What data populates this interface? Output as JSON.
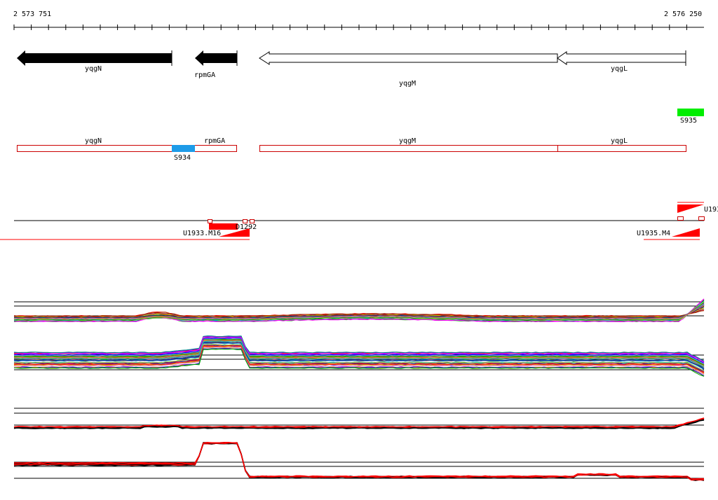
{
  "axis": {
    "start_label": "2 573 751",
    "end_label": "2 576 250"
  },
  "genes": [
    {
      "name": "yqgN",
      "strand": "reverse",
      "style": "filled"
    },
    {
      "name": "rpmGA",
      "strand": "reverse",
      "style": "filled"
    },
    {
      "name": "yqgM",
      "strand": "reverse",
      "style": "outline"
    },
    {
      "name": "yqgL",
      "strand": "reverse",
      "style": "outline"
    }
  ],
  "segments": [
    {
      "name": "S935",
      "color": "#00ee00"
    },
    {
      "name": "S934",
      "color": "#1e9be8"
    }
  ],
  "annotation_genes": [
    "yqgN",
    "rpmGA",
    "yqgM",
    "yqgL"
  ],
  "transcripts": [
    {
      "name": "U1933.M16"
    },
    {
      "name": "D1292"
    },
    {
      "name": "U1935.M4"
    },
    {
      "name": "U193"
    }
  ],
  "colors": {
    "gene_filled": "#000000",
    "gene_outline": "#000000",
    "annotation_box": "#cc0000",
    "transcript": "#ff0000"
  }
}
